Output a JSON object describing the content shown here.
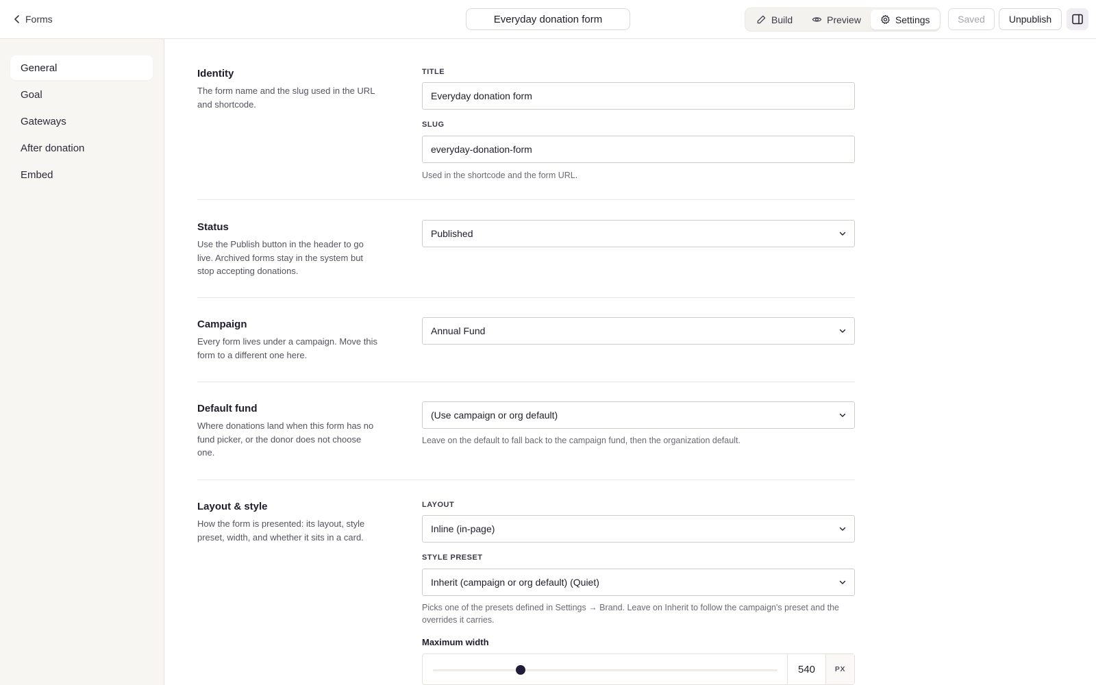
{
  "header": {
    "back_label": "Forms",
    "form_title": "Everyday donation form",
    "tabs": [
      {
        "label": "Build",
        "icon": "pencil-icon",
        "active": false
      },
      {
        "label": "Preview",
        "icon": "eye-icon",
        "active": false
      },
      {
        "label": "Settings",
        "icon": "gear-icon",
        "active": true
      }
    ],
    "saved_label": "Saved",
    "unpublish_label": "Unpublish",
    "panel_icon": "sidebar-panel-icon"
  },
  "sidebar": {
    "items": [
      {
        "label": "General",
        "active": true
      },
      {
        "label": "Goal",
        "active": false
      },
      {
        "label": "Gateways",
        "active": false
      },
      {
        "label": "After donation",
        "active": false
      },
      {
        "label": "Embed",
        "active": false
      }
    ]
  },
  "identity": {
    "title": "Identity",
    "description": "The form name and the slug used in the URL and shortcode.",
    "title_label": "TITLE",
    "title_value": "Everyday donation form",
    "slug_label": "SLUG",
    "slug_value": "everyday-donation-form",
    "slug_help": "Used in the shortcode and the form URL."
  },
  "status": {
    "title": "Status",
    "description": "Use the Publish button in the header to go live. Archived forms stay in the system but stop accepting donations.",
    "value": "Published"
  },
  "campaign": {
    "title": "Campaign",
    "description": "Every form lives under a campaign. Move this form to a different one here.",
    "value": "Annual Fund"
  },
  "default_fund": {
    "title": "Default fund",
    "description": "Where donations land when this form has no fund picker, or the donor does not choose one.",
    "value": "(Use campaign or org default)",
    "help": "Leave on the default to fall back to the campaign fund, then the organization default."
  },
  "layout_style": {
    "title": "Layout & style",
    "description": "How the form is presented: its layout, style preset, width, and whether it sits in a card.",
    "layout_label": "LAYOUT",
    "layout_value": "Inline (in-page)",
    "preset_label": "STYLE PRESET",
    "preset_value": "Inherit (campaign or org default) (Quiet)",
    "preset_help": "Picks one of the presets defined in Settings → Brand. Leave on Inherit to follow the campaign's preset and the overrides it carries.",
    "max_width_label": "Maximum width",
    "max_width_value": "540",
    "max_width_unit": "PX",
    "max_width_slider_fraction": 0.255
  }
}
